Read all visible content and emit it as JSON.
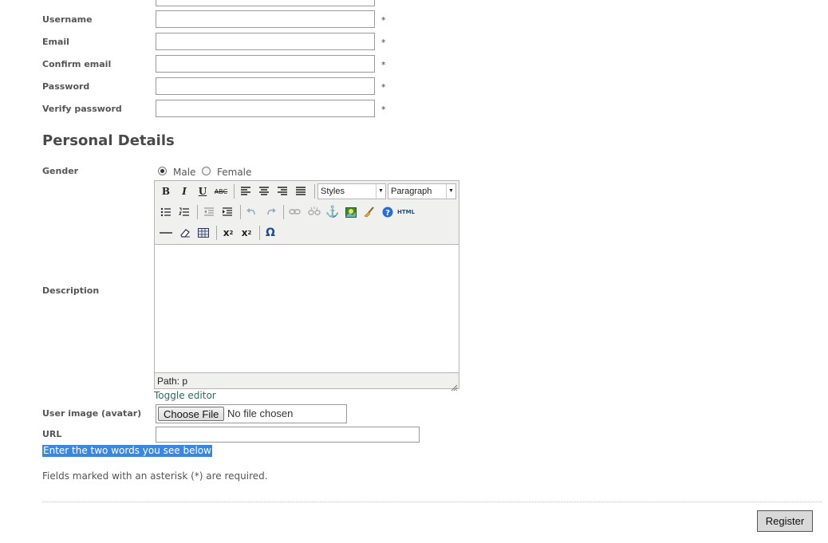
{
  "account": {
    "fields": [
      {
        "label": "Username",
        "required": "*"
      },
      {
        "label": "Email",
        "required": "*"
      },
      {
        "label": "Confirm email",
        "required": "*"
      },
      {
        "label": "Password",
        "required": "*"
      },
      {
        "label": "Verify password",
        "required": "*"
      }
    ]
  },
  "personal": {
    "heading": "Personal Details",
    "gender": {
      "label": "Gender",
      "options": [
        "Male",
        "Female"
      ],
      "selected": "Male"
    },
    "description": {
      "label": "Description",
      "styles_select": "Styles",
      "format_select": "Paragraph",
      "path": "Path: p",
      "toggle": "Toggle editor",
      "toolbar_icons": [
        "bold-icon",
        "italic-icon",
        "underline-icon",
        "strikethrough-icon",
        "align-left-icon",
        "align-center-icon",
        "align-right-icon",
        "align-justify-icon",
        "bullet-list-icon",
        "numbered-list-icon",
        "outdent-icon",
        "indent-icon",
        "undo-icon",
        "redo-icon",
        "link-icon",
        "unlink-icon",
        "anchor-icon",
        "image-icon",
        "cleanup-icon",
        "help-icon",
        "html-icon",
        "horizontal-rule-icon",
        "eraser-icon",
        "table-icon",
        "subscript-icon",
        "superscript-icon",
        "special-char-icon"
      ]
    },
    "avatar": {
      "label": "User image (avatar)",
      "button": "Choose File",
      "status": "No file chosen"
    },
    "url": {
      "label": "URL"
    }
  },
  "captcha_prompt": "Enter the two words you see below",
  "required_note": "Fields marked with an asterisk (*) are required.",
  "submit_label": "Register"
}
